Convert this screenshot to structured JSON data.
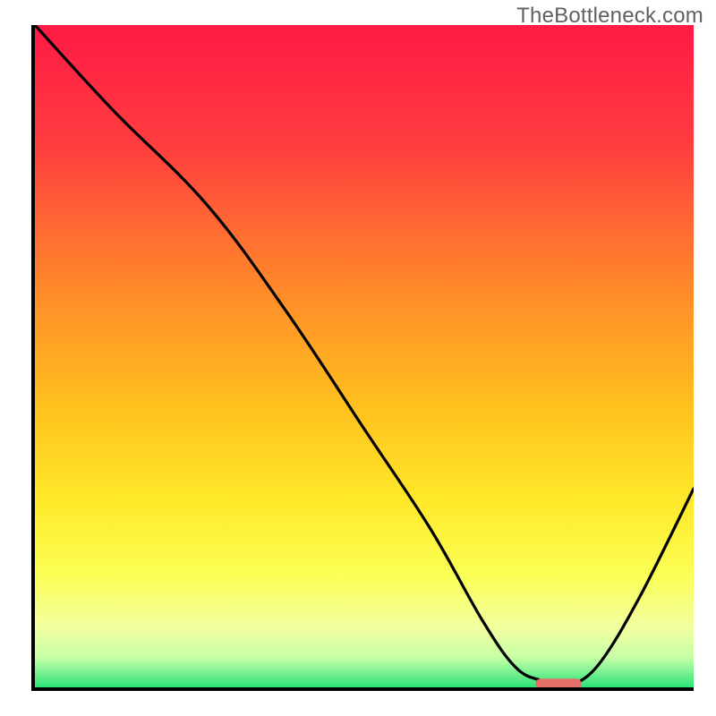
{
  "watermark": "TheBottleneck.com",
  "chart_data": {
    "type": "line",
    "title": "",
    "xlabel": "",
    "ylabel": "",
    "xlim": [
      0,
      100
    ],
    "ylim": [
      0,
      100
    ],
    "gradient_stops": [
      {
        "offset": 0.0,
        "color": "#ff1a45"
      },
      {
        "offset": 0.18,
        "color": "#ff3d3f"
      },
      {
        "offset": 0.4,
        "color": "#ff8a2a"
      },
      {
        "offset": 0.58,
        "color": "#ffc21e"
      },
      {
        "offset": 0.72,
        "color": "#ffe92a"
      },
      {
        "offset": 0.83,
        "color": "#fbff55"
      },
      {
        "offset": 0.91,
        "color": "#f2ffa0"
      },
      {
        "offset": 0.955,
        "color": "#c6ffa6"
      },
      {
        "offset": 1.0,
        "color": "#2de37a"
      }
    ],
    "series": [
      {
        "name": "bottleneck-curve",
        "x": [
          0,
          12,
          26,
          38,
          50,
          60,
          68,
          73,
          77,
          80,
          82,
          86,
          92,
          100
        ],
        "y": [
          100,
          87,
          73,
          57,
          39,
          24,
          10,
          3,
          1,
          0.5,
          0.5,
          4,
          14,
          30
        ]
      }
    ],
    "min_marker": {
      "x_start": 76,
      "x_end": 83,
      "y": 0.5
    }
  }
}
